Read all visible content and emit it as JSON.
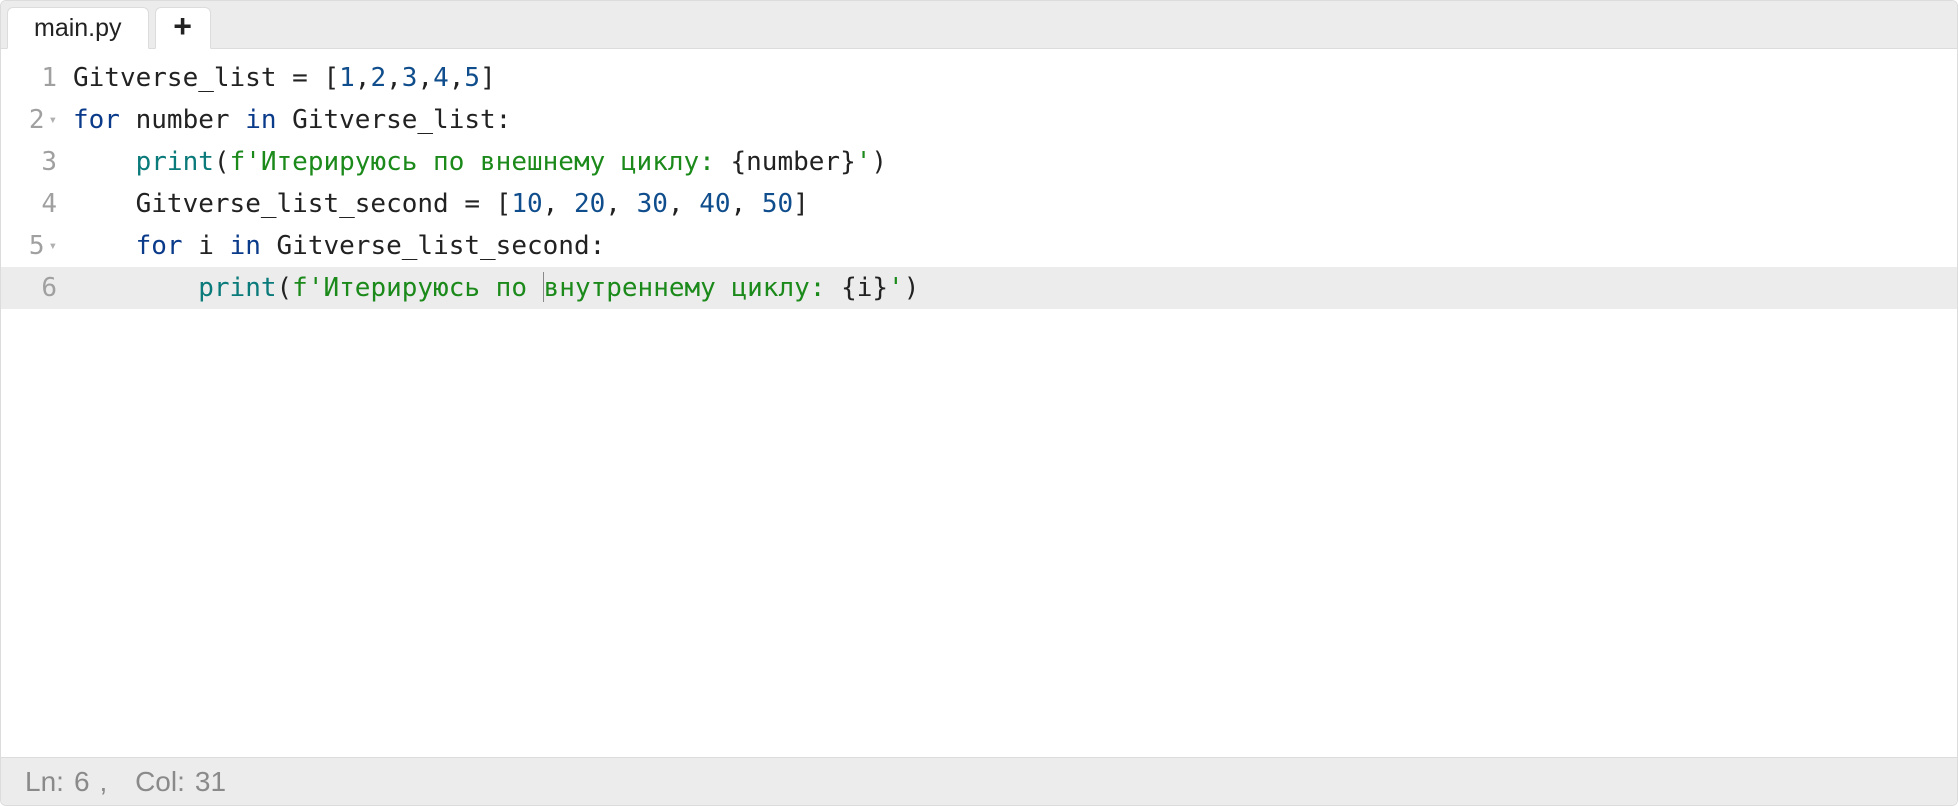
{
  "tabs": {
    "active": 0,
    "items": [
      {
        "label": "main.py"
      }
    ],
    "add_icon": "+"
  },
  "cursor": {
    "line": 6,
    "col": 31
  },
  "status": {
    "ln_label": "Ln:",
    "col_label": "Col:"
  },
  "gutter": {
    "lines": [
      "1",
      "2",
      "3",
      "4",
      "5",
      "6"
    ],
    "fold_icon": "▾",
    "folds_at": [
      2,
      5
    ],
    "active_line": 6
  },
  "code": {
    "lines": [
      {
        "tokens": [
          {
            "t": "id",
            "v": "Gitverse_list"
          },
          {
            "t": "op",
            "v": " = ["
          },
          {
            "t": "num",
            "v": "1"
          },
          {
            "t": "op",
            "v": ","
          },
          {
            "t": "num",
            "v": "2"
          },
          {
            "t": "op",
            "v": ","
          },
          {
            "t": "num",
            "v": "3"
          },
          {
            "t": "op",
            "v": ","
          },
          {
            "t": "num",
            "v": "4"
          },
          {
            "t": "op",
            "v": ","
          },
          {
            "t": "num",
            "v": "5"
          },
          {
            "t": "op",
            "v": "]"
          }
        ],
        "indent": 0
      },
      {
        "tokens": [
          {
            "t": "kw",
            "v": "for"
          },
          {
            "t": "op",
            "v": " "
          },
          {
            "t": "id",
            "v": "number"
          },
          {
            "t": "op",
            "v": " "
          },
          {
            "t": "kw",
            "v": "in"
          },
          {
            "t": "op",
            "v": " "
          },
          {
            "t": "id",
            "v": "Gitverse_list"
          },
          {
            "t": "op",
            "v": ":"
          }
        ],
        "indent": 0
      },
      {
        "tokens": [
          {
            "t": "fn",
            "v": "print"
          },
          {
            "t": "op",
            "v": "("
          },
          {
            "t": "strp",
            "v": "f"
          },
          {
            "t": "str",
            "v": "'Итерируюсь по внешнему циклу: "
          },
          {
            "t": "op",
            "v": "{"
          },
          {
            "t": "id",
            "v": "number"
          },
          {
            "t": "op",
            "v": "}"
          },
          {
            "t": "str",
            "v": "'"
          },
          {
            "t": "op",
            "v": ")"
          }
        ],
        "indent": 1
      },
      {
        "tokens": [
          {
            "t": "id",
            "v": "Gitverse_list_second"
          },
          {
            "t": "op",
            "v": " = ["
          },
          {
            "t": "num",
            "v": "10"
          },
          {
            "t": "op",
            "v": ", "
          },
          {
            "t": "num",
            "v": "20"
          },
          {
            "t": "op",
            "v": ", "
          },
          {
            "t": "num",
            "v": "30"
          },
          {
            "t": "op",
            "v": ", "
          },
          {
            "t": "num",
            "v": "40"
          },
          {
            "t": "op",
            "v": ", "
          },
          {
            "t": "num",
            "v": "50"
          },
          {
            "t": "op",
            "v": "]"
          }
        ],
        "indent": 1
      },
      {
        "tokens": [
          {
            "t": "kw",
            "v": "for"
          },
          {
            "t": "op",
            "v": " "
          },
          {
            "t": "id",
            "v": "i"
          },
          {
            "t": "op",
            "v": " "
          },
          {
            "t": "kw",
            "v": "in"
          },
          {
            "t": "op",
            "v": " "
          },
          {
            "t": "id",
            "v": "Gitverse_list_second"
          },
          {
            "t": "op",
            "v": ":"
          }
        ],
        "indent": 1
      },
      {
        "tokens": [
          {
            "t": "fn",
            "v": "print"
          },
          {
            "t": "op",
            "v": "("
          },
          {
            "t": "strp",
            "v": "f"
          },
          {
            "t": "str",
            "v": "'Итерируюсь по "
          },
          {
            "t": "cursor"
          },
          {
            "t": "str",
            "v": "внутреннему циклу: "
          },
          {
            "t": "op",
            "v": "{"
          },
          {
            "t": "id",
            "v": "i"
          },
          {
            "t": "op",
            "v": "}"
          },
          {
            "t": "str",
            "v": "'"
          },
          {
            "t": "op",
            "v": ")"
          }
        ],
        "indent": 2
      }
    ]
  },
  "colors": {
    "keyword": "#0a3a8a",
    "function": "#0a7a7a",
    "number": "#0f4d8c",
    "string": "#1b8a1b",
    "gutter": "#a0a0a0",
    "tabbar": "#ececec"
  }
}
